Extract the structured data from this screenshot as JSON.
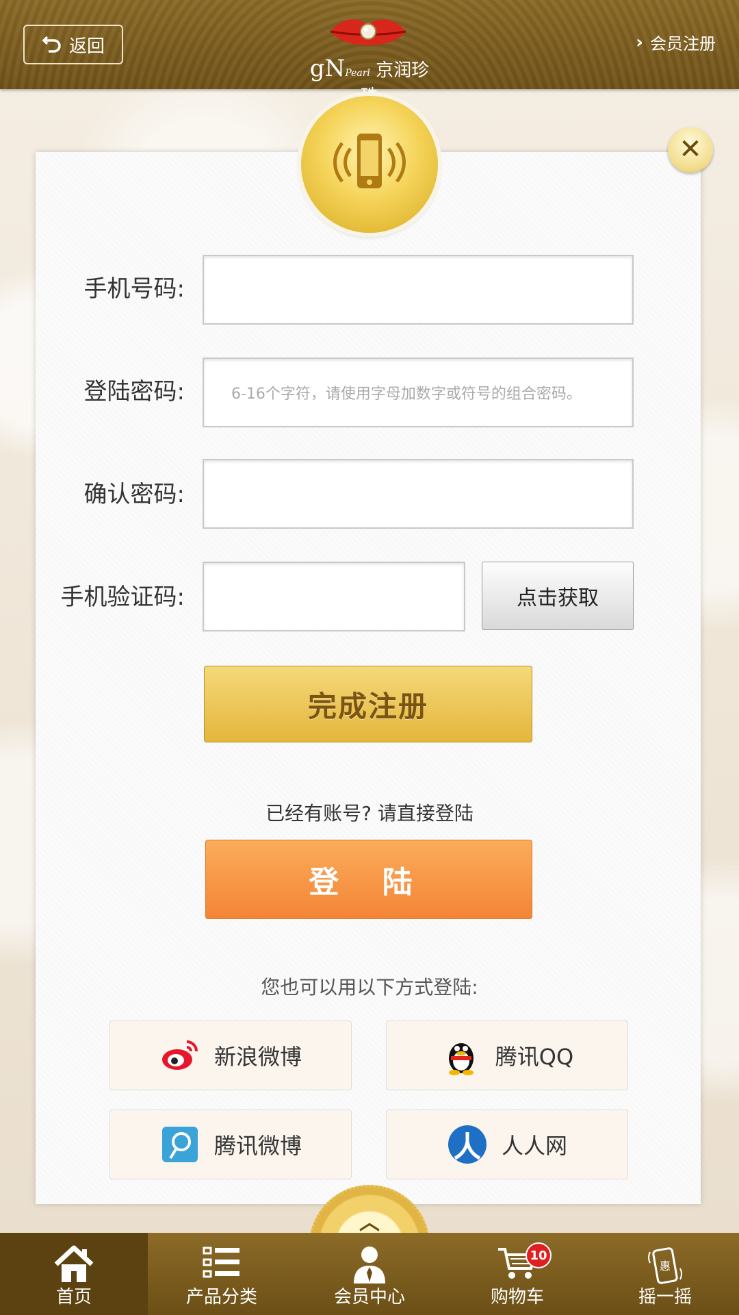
{
  "header": {
    "back_label": "返回",
    "logo_gn": "gN",
    "logo_pearl": "Pearl",
    "logo_name": "京润珍珠",
    "register_label": "会员注册"
  },
  "form": {
    "phone_label": "手机号码:",
    "phone_value": "",
    "password_label": "登陆密码:",
    "password_placeholder": "6-16个字符，请使用字母加数字或符号的组合密码。",
    "confirm_label": "确认密码:",
    "confirm_value": "",
    "code_label": "手机验证码:",
    "code_value": "",
    "get_code_label": "点击获取",
    "submit_label": "完成注册"
  },
  "login": {
    "prompt": "已经有账号? 请直接登陆",
    "button_label": "登 陆",
    "alt_prompt": "您也可以用以下方式登陆:"
  },
  "social": [
    {
      "label": "新浪微博",
      "icon": "sina-weibo-icon"
    },
    {
      "label": "腾讯QQ",
      "icon": "qq-icon"
    },
    {
      "label": "腾讯微博",
      "icon": "tencent-weibo-icon"
    },
    {
      "label": "人人网",
      "icon": "renren-icon"
    }
  ],
  "nav": [
    {
      "label": "首页",
      "icon": "home-icon",
      "active": true
    },
    {
      "label": "产品分类",
      "icon": "list-icon"
    },
    {
      "label": "会员中心",
      "icon": "user-icon"
    },
    {
      "label": "购物车",
      "icon": "cart-icon",
      "badge": "10"
    },
    {
      "label": "摇一摇",
      "icon": "shake-phone-icon",
      "icon_text": "惠"
    }
  ],
  "colors": {
    "header_brown": "#7a5c1f",
    "gold_button": "#e9c154",
    "orange_button": "#f58b3b"
  }
}
